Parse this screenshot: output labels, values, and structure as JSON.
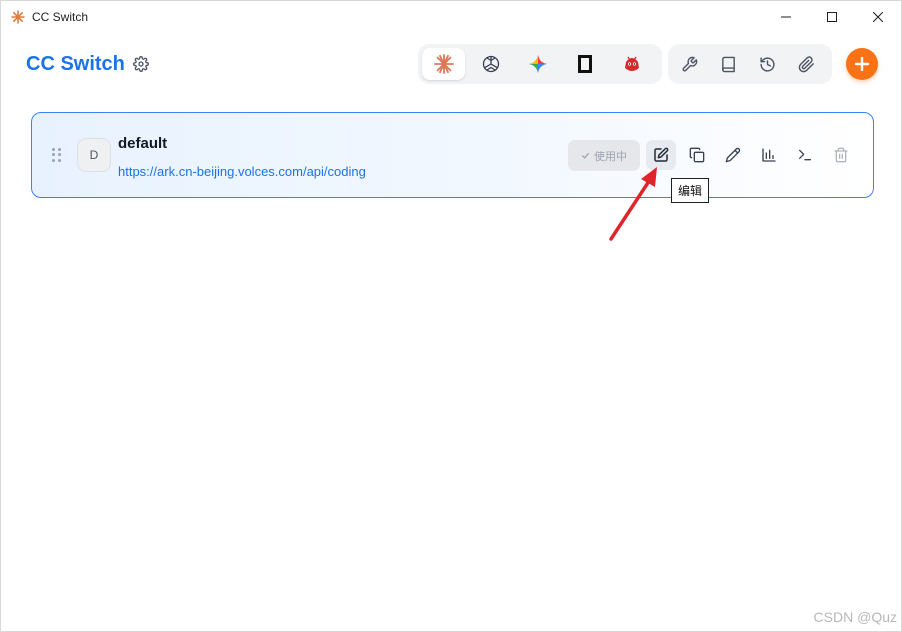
{
  "window": {
    "title": "CC Switch",
    "controls": [
      "minimize",
      "maximize",
      "close"
    ]
  },
  "header": {
    "brand": "CC Switch",
    "app_tabs": [
      {
        "name": "claude-icon",
        "active": true
      },
      {
        "name": "openai-icon",
        "active": false
      },
      {
        "name": "gemini-icon",
        "active": false
      },
      {
        "name": "terminal-app-icon",
        "active": false
      },
      {
        "name": "robot-app-icon",
        "active": false
      }
    ],
    "tool_buttons": [
      "wrench-icon",
      "book-icon",
      "history-icon",
      "paperclip-icon"
    ],
    "add_label": "+"
  },
  "provider": {
    "avatar_letter": "D",
    "name": "default",
    "url": "https://ark.cn-beijing.volces.com/api/coding",
    "in_use_label": "使用中",
    "actions": [
      "edit-icon",
      "duplicate-icon",
      "pencil-icon",
      "stats-icon",
      "terminal-icon",
      "trash-icon"
    ]
  },
  "tooltip": {
    "text": "编辑"
  },
  "watermark": "CSDN @Quz",
  "colors": {
    "brand": "#1a73e8",
    "accent_orange": "#f97316",
    "card_border": "#3b82f6",
    "annotation_red": "#e0242b"
  }
}
